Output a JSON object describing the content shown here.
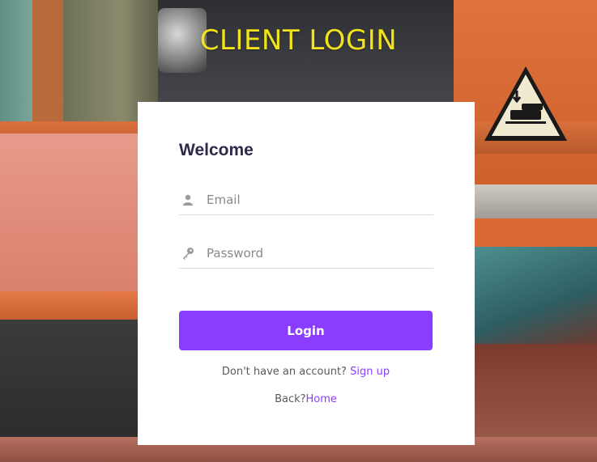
{
  "header": {
    "title": "CLIENT LOGIN"
  },
  "form": {
    "heading": "Welcome",
    "email_placeholder": "Email",
    "password_placeholder": "Password",
    "login_label": "Login",
    "signup_prompt": "Don't have an account?",
    "signup_link": "Sign up",
    "back_prompt": "Back?",
    "home_link": "Home"
  },
  "icons": {
    "email": "user-icon",
    "password": "key-icon",
    "warning": "hand-crush-warning-icon"
  },
  "colors": {
    "title": "#f2e21c",
    "accent": "#8b3dff",
    "heading": "#2d2a4a",
    "card": "#ffffff"
  }
}
